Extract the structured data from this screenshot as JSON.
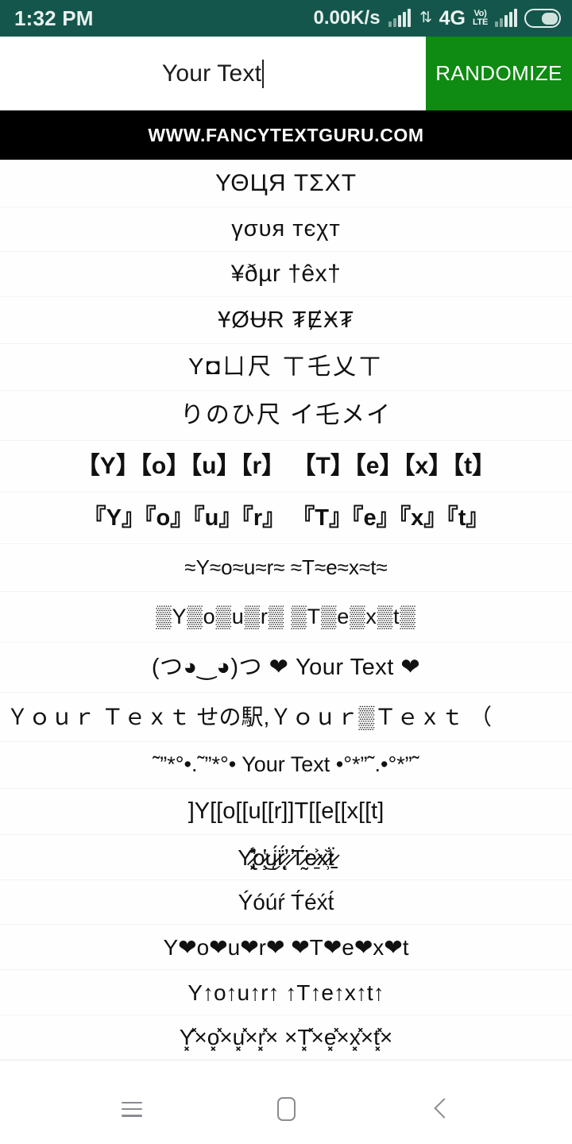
{
  "status_bar": {
    "clock": "1:32 PM",
    "data_speed": "0.00K/s",
    "network_type": "4G",
    "volte_top": "Vo)",
    "volte_bottom": "LTE",
    "icons": [
      "signal-bars-icon",
      "data-transfer-icon",
      "volte-icon",
      "signal-bars-icon",
      "battery-icon"
    ],
    "background_color": "#14564c"
  },
  "input_bar": {
    "value": "Your Text",
    "placeholder": "Your Text",
    "randomize_label": "RANDOMIZE",
    "button_color": "#0f8a12"
  },
  "banner": {
    "text": "WWW.FANCYTEXTGURU.COM",
    "background_color": "#000000"
  },
  "results": [
    {
      "id": 1,
      "text": "ΥΘЦЯ ΤΣΧΤ"
    },
    {
      "id": 2,
      "text": "γσυя тєχт"
    },
    {
      "id": 3,
      "text": "¥ðµr †êx†"
    },
    {
      "id": 4,
      "text": "ҰØɄɌ ₮ɆӾ₮"
    },
    {
      "id": 5,
      "text": "Y◘ㄩ尺 ㄒ乇乂ㄒ"
    },
    {
      "id": 6,
      "text": "りのひ尺 イ乇メイ"
    },
    {
      "id": 7,
      "text": "【Y】【o】【u】【r】 【T】【e】【x】【t】"
    },
    {
      "id": 8,
      "text": "『Y』『o』『u』『r』 『T』『e』『x』『t』"
    },
    {
      "id": 9,
      "text": "≈Y≈o≈u≈r≈ ≈T≈e≈x≈t≈"
    },
    {
      "id": 10,
      "text": "▒Y▒o▒u▒r▒ ▒T▒e▒x▒t▒"
    },
    {
      "id": 11,
      "text": "(つ◕‿◕)つ ❤ Your Text ❤"
    },
    {
      "id": 12,
      "text": "Ｙｏｕｒ Ｔｅｘｔ せの駅,Ｙｏｕｒ▒Ｔｅｘｔ （"
    },
    {
      "id": 13,
      "text": "˜”*°•.˜”*°• Your Text •°*”˜.•°*”˜"
    },
    {
      "id": 14,
      "text": "]Y[[o[[u[[r]]T[[e[[x[[t]"
    },
    {
      "id": 15,
      "text": "Y̷̢̛͓͔̾̽o̷̧̔͜ų̷̈́r̷̨̛͎̈́ ̷̛T̷̰̈́e̷̱͐x̷̹̆ẗ̷̠"
    },
    {
      "id": 16,
      "text": "Ýóúŕ T́éx́t́"
    },
    {
      "id": 17,
      "text": "Y❤o❤u❤r❤ ❤T❤e❤x❤t"
    },
    {
      "id": 18,
      "text": "Y↑o↑u↑r↑ ↑T↑e↑x↑t↑"
    },
    {
      "id": 19,
      "text": "Y͓̽×o͓̽×u͓̽×r͓̽× ×T͓̽×e͓̽×x͓̽×t͓̽×"
    }
  ],
  "nav_bar": {
    "menu_label": "Menu",
    "home_label": "Home",
    "back_label": "Back",
    "icon_color": "#8b8b92"
  }
}
